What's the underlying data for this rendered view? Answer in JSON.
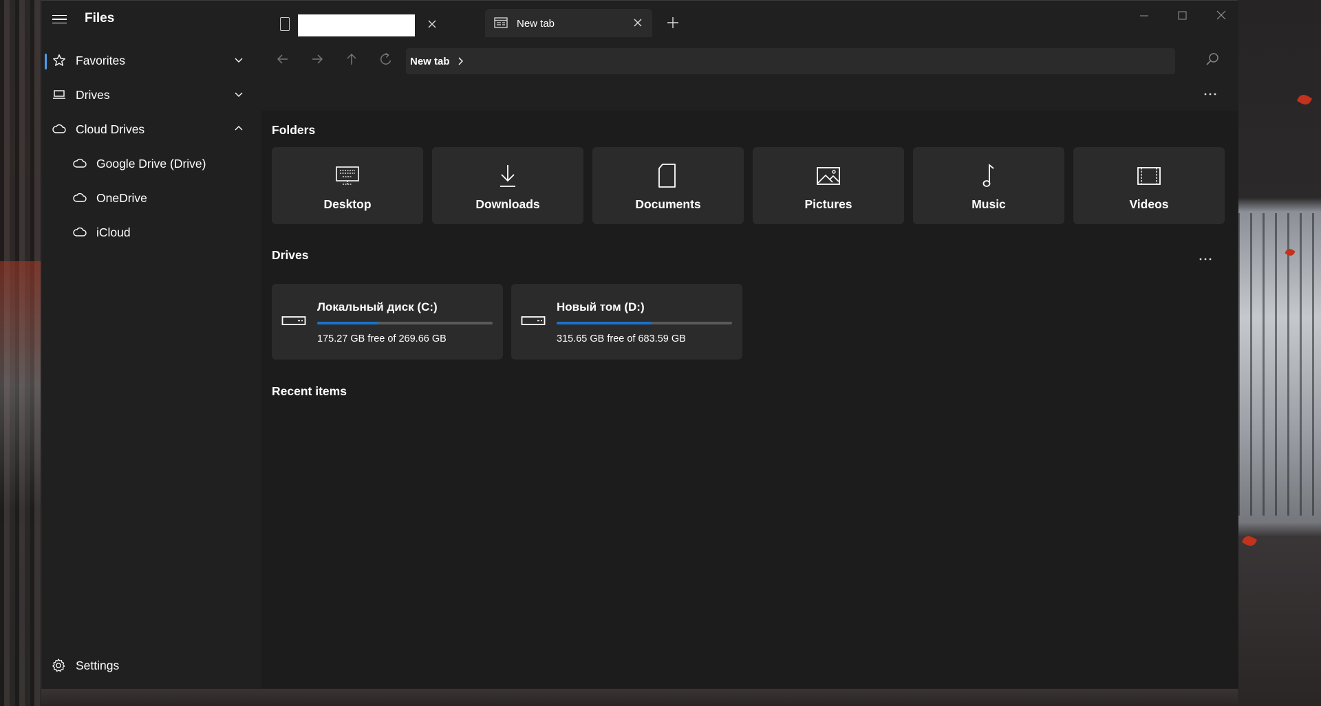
{
  "app": {
    "title": "Files"
  },
  "sidebar": {
    "items": [
      {
        "label": "Favorites",
        "icon": "star-icon",
        "expanded": false
      },
      {
        "label": "Drives",
        "icon": "drive-icon",
        "expanded": false
      },
      {
        "label": "Cloud Drives",
        "icon": "cloud-icon",
        "expanded": true
      }
    ],
    "cloud_children": [
      {
        "label": "Google Drive (Drive)",
        "icon": "cloud-icon"
      },
      {
        "label": "OneDrive",
        "icon": "cloud-icon"
      },
      {
        "label": "iCloud",
        "icon": "cloud-icon"
      }
    ],
    "settings_label": "Settings"
  },
  "tabs": [
    {
      "label": "",
      "active": false
    },
    {
      "label": "New tab",
      "active": true
    }
  ],
  "address": {
    "crumb": "New tab"
  },
  "sections": {
    "folders_title": "Folders",
    "drives_title": "Drives",
    "recent_title": "Recent items"
  },
  "folders": [
    {
      "label": "Desktop",
      "icon": "desktop-icon"
    },
    {
      "label": "Downloads",
      "icon": "download-icon"
    },
    {
      "label": "Documents",
      "icon": "document-icon"
    },
    {
      "label": "Pictures",
      "icon": "picture-icon"
    },
    {
      "label": "Music",
      "icon": "music-icon"
    },
    {
      "label": "Videos",
      "icon": "video-icon"
    }
  ],
  "drives": [
    {
      "name": "Локальный диск (C:)",
      "free_text": "175.27 GB free of 269.66 GB",
      "used_fraction": 0.35
    },
    {
      "name": "Новый том (D:)",
      "free_text": "315.65 GB free of 683.59 GB",
      "used_fraction": 0.54
    }
  ],
  "colors": {
    "accent": "#1a73c9",
    "window_bg": "#202020",
    "content_bg": "#1c1c1c",
    "card_bg": "#2b2b2b"
  }
}
